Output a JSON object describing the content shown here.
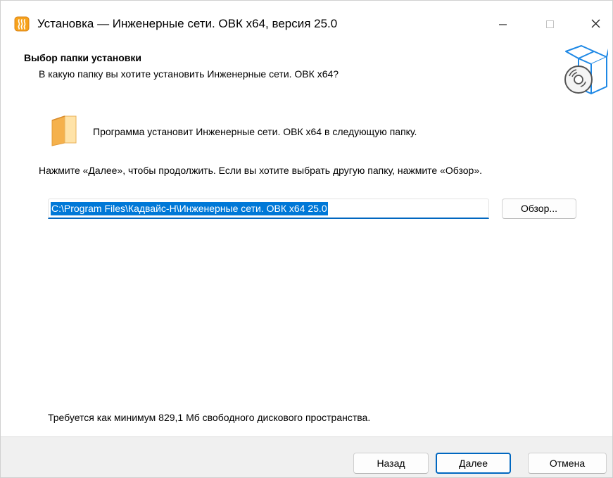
{
  "window": {
    "title": "Установка — Инженерные сети. ОВК x64, версия 25.0",
    "app_icon": "steam-heater-icon",
    "controls": {
      "minimize_icon": "minimize-icon",
      "maximize_icon": "maximize-icon",
      "close_icon": "close-icon"
    }
  },
  "header": {
    "title": "Выбор папки установки",
    "subtitle": "В какую папку вы хотите установить Инженерные сети. ОВК x64?",
    "icon": "setup-box-icon"
  },
  "body": {
    "folder_icon": "folder-icon",
    "info_text": "Программа установит Инженерные сети. ОВК x64 в следующую папку.",
    "continue_text": "Нажмите «Далее», чтобы продолжить. Если вы хотите выбрать другую папку, нажмите «Обзор».",
    "path_value": "C:\\Program Files\\Кадвайс-Н\\Инженерные сети. ОВК x64 25.0",
    "browse_label": "Обзор...",
    "space_text": "Требуется как минимум 829,1 Мб свободного дискового пространства."
  },
  "footer": {
    "back_label": "Назад",
    "next_label": "Далее",
    "cancel_label": "Отмена"
  },
  "colors": {
    "accent": "#0067c0",
    "selection": "#0078d7",
    "footer_bg": "#f0f0f0",
    "folder": "#f5b14c"
  }
}
